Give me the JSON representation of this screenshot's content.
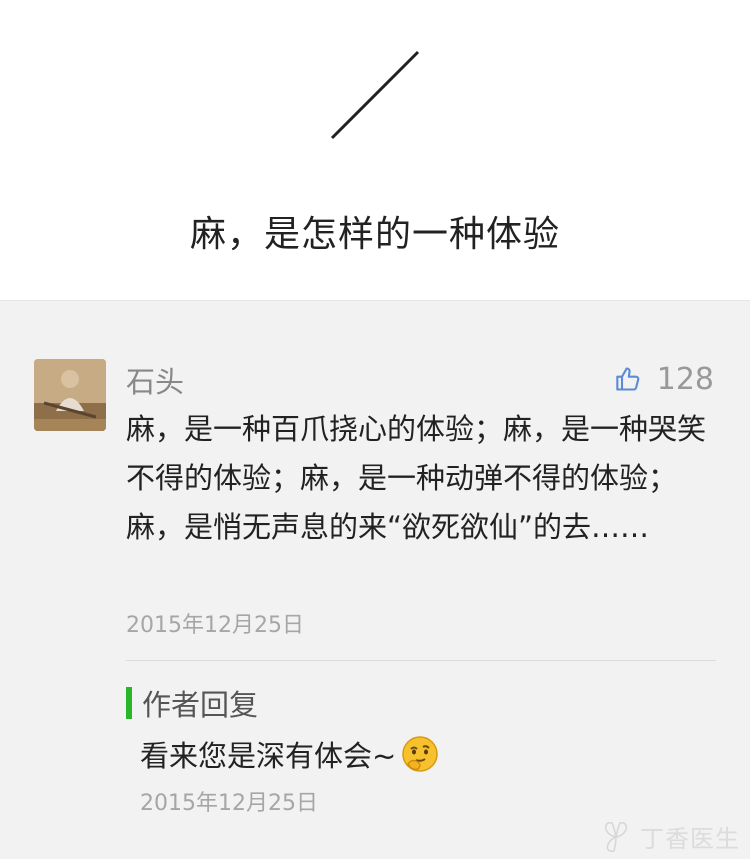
{
  "header": {
    "title": "麻，是怎样的一种体验"
  },
  "comment": {
    "author": "石头",
    "likes": "128",
    "text": "麻，是一种百爪挠心的体验；麻，是一种哭笑不得的体验；麻，是一种动弹不得的体验；麻，是悄无声息的来“欲死欲仙”的去……",
    "date": "2015年12月25日",
    "icons": [
      "avatar",
      "thumbs-up-icon"
    ]
  },
  "reply": {
    "label": "作者回复",
    "text": "看来您是深有体会~",
    "date": "2015年12月25日",
    "icons": [
      "thinking-face-emoji"
    ]
  },
  "watermark": {
    "text": "丁香医生"
  },
  "colors": {
    "accent_green": "#2bb52b",
    "like_blue": "#5b8bd6",
    "panel_bg": "#f2f2f2"
  }
}
